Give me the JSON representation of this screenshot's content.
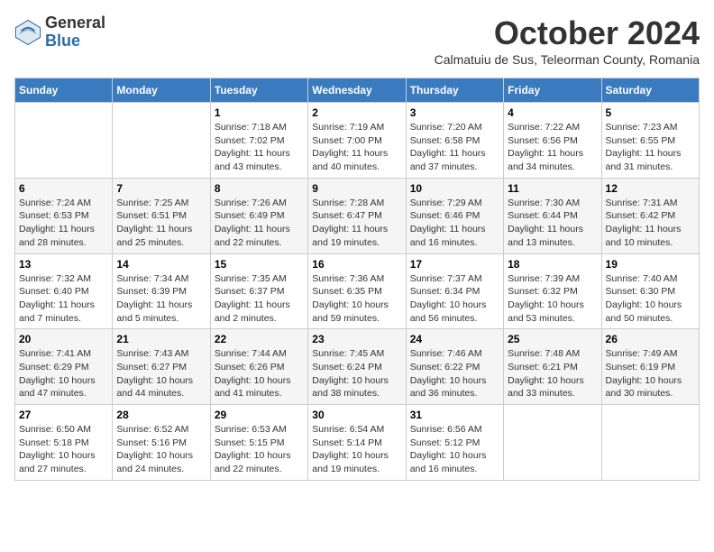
{
  "logo": {
    "general": "General",
    "blue": "Blue"
  },
  "title": "October 2024",
  "subtitle": "Calmatuiu de Sus, Teleorman County, Romania",
  "days_of_week": [
    "Sunday",
    "Monday",
    "Tuesday",
    "Wednesday",
    "Thursday",
    "Friday",
    "Saturday"
  ],
  "weeks": [
    [
      {
        "day": "",
        "info": ""
      },
      {
        "day": "",
        "info": ""
      },
      {
        "day": "1",
        "info": "Sunrise: 7:18 AM\nSunset: 7:02 PM\nDaylight: 11 hours and 43 minutes."
      },
      {
        "day": "2",
        "info": "Sunrise: 7:19 AM\nSunset: 7:00 PM\nDaylight: 11 hours and 40 minutes."
      },
      {
        "day": "3",
        "info": "Sunrise: 7:20 AM\nSunset: 6:58 PM\nDaylight: 11 hours and 37 minutes."
      },
      {
        "day": "4",
        "info": "Sunrise: 7:22 AM\nSunset: 6:56 PM\nDaylight: 11 hours and 34 minutes."
      },
      {
        "day": "5",
        "info": "Sunrise: 7:23 AM\nSunset: 6:55 PM\nDaylight: 11 hours and 31 minutes."
      }
    ],
    [
      {
        "day": "6",
        "info": "Sunrise: 7:24 AM\nSunset: 6:53 PM\nDaylight: 11 hours and 28 minutes."
      },
      {
        "day": "7",
        "info": "Sunrise: 7:25 AM\nSunset: 6:51 PM\nDaylight: 11 hours and 25 minutes."
      },
      {
        "day": "8",
        "info": "Sunrise: 7:26 AM\nSunset: 6:49 PM\nDaylight: 11 hours and 22 minutes."
      },
      {
        "day": "9",
        "info": "Sunrise: 7:28 AM\nSunset: 6:47 PM\nDaylight: 11 hours and 19 minutes."
      },
      {
        "day": "10",
        "info": "Sunrise: 7:29 AM\nSunset: 6:46 PM\nDaylight: 11 hours and 16 minutes."
      },
      {
        "day": "11",
        "info": "Sunrise: 7:30 AM\nSunset: 6:44 PM\nDaylight: 11 hours and 13 minutes."
      },
      {
        "day": "12",
        "info": "Sunrise: 7:31 AM\nSunset: 6:42 PM\nDaylight: 11 hours and 10 minutes."
      }
    ],
    [
      {
        "day": "13",
        "info": "Sunrise: 7:32 AM\nSunset: 6:40 PM\nDaylight: 11 hours and 7 minutes."
      },
      {
        "day": "14",
        "info": "Sunrise: 7:34 AM\nSunset: 6:39 PM\nDaylight: 11 hours and 5 minutes."
      },
      {
        "day": "15",
        "info": "Sunrise: 7:35 AM\nSunset: 6:37 PM\nDaylight: 11 hours and 2 minutes."
      },
      {
        "day": "16",
        "info": "Sunrise: 7:36 AM\nSunset: 6:35 PM\nDaylight: 10 hours and 59 minutes."
      },
      {
        "day": "17",
        "info": "Sunrise: 7:37 AM\nSunset: 6:34 PM\nDaylight: 10 hours and 56 minutes."
      },
      {
        "day": "18",
        "info": "Sunrise: 7:39 AM\nSunset: 6:32 PM\nDaylight: 10 hours and 53 minutes."
      },
      {
        "day": "19",
        "info": "Sunrise: 7:40 AM\nSunset: 6:30 PM\nDaylight: 10 hours and 50 minutes."
      }
    ],
    [
      {
        "day": "20",
        "info": "Sunrise: 7:41 AM\nSunset: 6:29 PM\nDaylight: 10 hours and 47 minutes."
      },
      {
        "day": "21",
        "info": "Sunrise: 7:43 AM\nSunset: 6:27 PM\nDaylight: 10 hours and 44 minutes."
      },
      {
        "day": "22",
        "info": "Sunrise: 7:44 AM\nSunset: 6:26 PM\nDaylight: 10 hours and 41 minutes."
      },
      {
        "day": "23",
        "info": "Sunrise: 7:45 AM\nSunset: 6:24 PM\nDaylight: 10 hours and 38 minutes."
      },
      {
        "day": "24",
        "info": "Sunrise: 7:46 AM\nSunset: 6:22 PM\nDaylight: 10 hours and 36 minutes."
      },
      {
        "day": "25",
        "info": "Sunrise: 7:48 AM\nSunset: 6:21 PM\nDaylight: 10 hours and 33 minutes."
      },
      {
        "day": "26",
        "info": "Sunrise: 7:49 AM\nSunset: 6:19 PM\nDaylight: 10 hours and 30 minutes."
      }
    ],
    [
      {
        "day": "27",
        "info": "Sunrise: 6:50 AM\nSunset: 5:18 PM\nDaylight: 10 hours and 27 minutes."
      },
      {
        "day": "28",
        "info": "Sunrise: 6:52 AM\nSunset: 5:16 PM\nDaylight: 10 hours and 24 minutes."
      },
      {
        "day": "29",
        "info": "Sunrise: 6:53 AM\nSunset: 5:15 PM\nDaylight: 10 hours and 22 minutes."
      },
      {
        "day": "30",
        "info": "Sunrise: 6:54 AM\nSunset: 5:14 PM\nDaylight: 10 hours and 19 minutes."
      },
      {
        "day": "31",
        "info": "Sunrise: 6:56 AM\nSunset: 5:12 PM\nDaylight: 10 hours and 16 minutes."
      },
      {
        "day": "",
        "info": ""
      },
      {
        "day": "",
        "info": ""
      }
    ]
  ]
}
